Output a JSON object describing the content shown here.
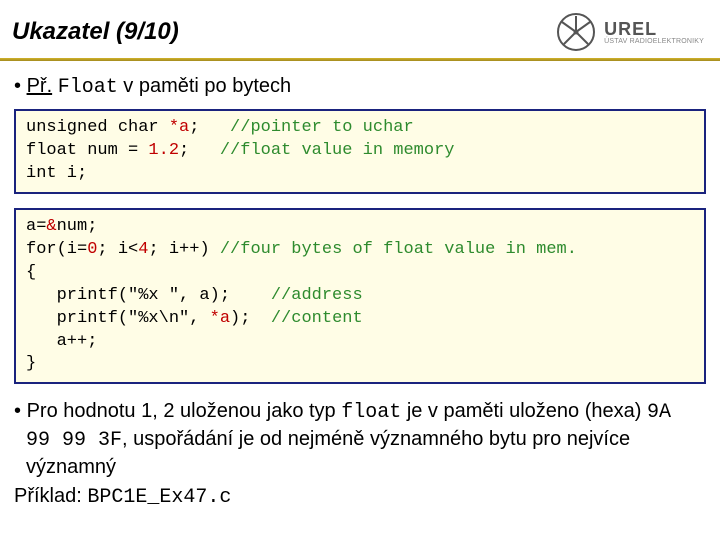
{
  "header": {
    "title": "Ukazatel (9/10)",
    "logo": {
      "main": "UREL",
      "sub": "ÚSTAV RADIOELEKTRONIKY"
    }
  },
  "intro": {
    "prefix": "Př.",
    "code": "Float",
    "rest": " v paměti po bytech"
  },
  "code1": {
    "l1a": "unsigned char ",
    "l1b": "*a",
    "l1c": ";   ",
    "l1d": "//pointer to uchar",
    "l2a": "float num = ",
    "l2b": "1.2",
    "l2c": ";   ",
    "l2d": "//float value in memory",
    "l3": "int i;"
  },
  "code2": {
    "l1a": "a=",
    "l1b": "&",
    "l1c": "num;",
    "l2a": "for(i=",
    "l2b": "0",
    "l2c": "; i<",
    "l2d": "4",
    "l2e": "; i++) ",
    "l2f": "//four bytes of float value in mem.",
    "l3": "{",
    "l4a": "   printf(\"%x \", a);    ",
    "l4b": "//address",
    "l5a": "   printf(\"%x\\n\", ",
    "l5b": "*a",
    "l5c": ");  ",
    "l5d": "//content",
    "l6": "   a++;",
    "l7": "}"
  },
  "note": {
    "t1": "Pro hodnotu 1, 2 uloženou jako typ ",
    "c1": "float",
    "t2": " je v paměti uloženo (hexa) ",
    "c2": "9A 99 99 3F",
    "t3": ", uspořádání je od nejméně významného bytu pro nejvíce významný"
  },
  "example": {
    "label": "Příklad: ",
    "file": "BPC1E_Ex47.c"
  }
}
